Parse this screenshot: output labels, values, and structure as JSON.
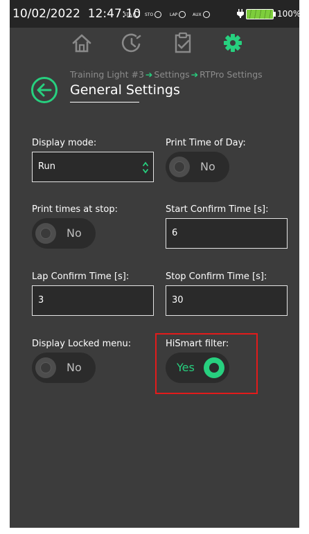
{
  "status_bar": {
    "date": "10/02/2022",
    "time": "12:47:10",
    "indicators": [
      "STA",
      "STO",
      "LAP",
      "AUX"
    ],
    "battery_percent": "100%"
  },
  "nav": {
    "icons": [
      "home-icon",
      "timer-icon",
      "clipboard-icon",
      "gear-icon"
    ],
    "active": "gear-icon",
    "accent_color": "#27d07f"
  },
  "breadcrumb": [
    "Training Light #3",
    "Settings",
    "RTPro Settings"
  ],
  "page_title": "General Settings",
  "fields": {
    "display_mode": {
      "label": "Display mode:",
      "value": "Run"
    },
    "print_time_of_day": {
      "label": "Print Time of Day:",
      "value": "No"
    },
    "print_times_at_stop": {
      "label": "Print times at stop:",
      "value": "No"
    },
    "start_confirm_time": {
      "label": "Start Confirm Time [s]:",
      "value": "6"
    },
    "lap_confirm_time": {
      "label": "Lap Confirm Time [s]:",
      "value": "3"
    },
    "stop_confirm_time": {
      "label": "Stop Confirm Time [s]:",
      "value": "30"
    },
    "display_locked_menu": {
      "label": "Display Locked menu:",
      "value": "No"
    },
    "hismart_filter": {
      "label": "HiSmart filter:",
      "value": "Yes"
    }
  }
}
